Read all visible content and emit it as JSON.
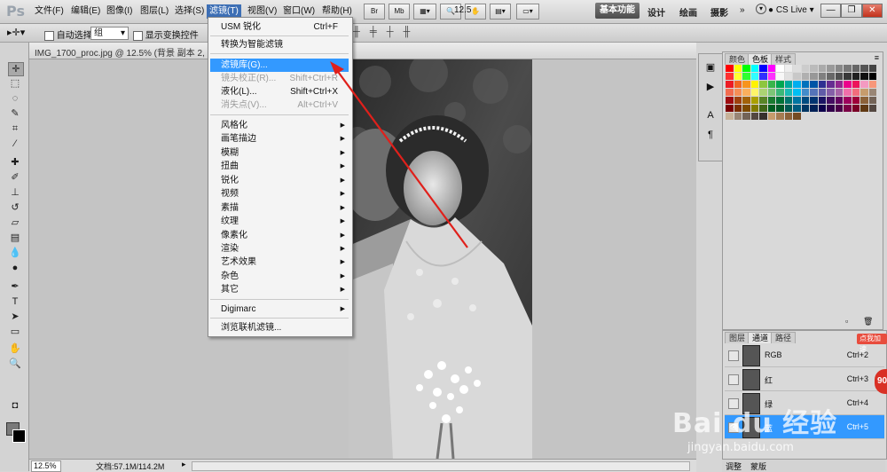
{
  "menubar": {
    "logo": "Ps",
    "items": [
      "文件(F)",
      "编辑(E)",
      "图像(I)",
      "图层(L)",
      "选择(S)",
      "滤镜(T)",
      "视图(V)",
      "窗口(W)",
      "帮助(H)"
    ],
    "zoom": "12.5",
    "workspace_active": "基本功能",
    "workspaces": [
      "设计",
      "绘画",
      "摄影"
    ],
    "cs_live": "CS Live",
    "bridge_btn": "Br",
    "mini_btn": "Mb"
  },
  "options": {
    "auto_select_label": "自动选择:",
    "group_value": "组",
    "transform_label": "显示变换控件"
  },
  "document": {
    "title": "IMG_1700_proc.jpg @ 12.5% (背景 副本 2, 蓝/8)",
    "status_zoom": "12.5%",
    "status_doc": "文档:57.1M/114.2M"
  },
  "filter_menu": {
    "items": [
      {
        "label": "USM 锐化",
        "shortcut": "Ctrl+F"
      },
      {
        "label": "转换为智能滤镜",
        "shortcut": ""
      },
      {
        "label": "滤镜库(G)...",
        "shortcut": ""
      },
      {
        "label": "镜头校正(R)...",
        "shortcut": "Shift+Ctrl+R"
      },
      {
        "label": "液化(L)...",
        "shortcut": "Shift+Ctrl+X"
      },
      {
        "label": "消失点(V)...",
        "shortcut": "Alt+Ctrl+V"
      },
      {
        "label": "风格化"
      },
      {
        "label": "画笔描边"
      },
      {
        "label": "模糊"
      },
      {
        "label": "扭曲"
      },
      {
        "label": "锐化"
      },
      {
        "label": "视频"
      },
      {
        "label": "素描"
      },
      {
        "label": "纹理"
      },
      {
        "label": "像素化"
      },
      {
        "label": "渲染"
      },
      {
        "label": "艺术效果"
      },
      {
        "label": "杂色"
      },
      {
        "label": "其它"
      },
      {
        "label": "Digimarc"
      },
      {
        "label": "浏览联机滤镜..."
      }
    ]
  },
  "swatch_panel": {
    "tabs": [
      "颜色",
      "色板",
      "样式"
    ],
    "colors": [
      "#ff0000",
      "#ffff00",
      "#00ff00",
      "#00ffff",
      "#0000ff",
      "#ff00ff",
      "#ffffff",
      "#eeeeee",
      "#dddddd",
      "#cccccc",
      "#bbbbbb",
      "#aaaaaa",
      "#999999",
      "#888888",
      "#777777",
      "#666666",
      "#555555",
      "#444444",
      "#ff3030",
      "#ffff30",
      "#30ff30",
      "#30ffff",
      "#3030ff",
      "#ff30ff",
      "#f7f7f7",
      "#e0e0e0",
      "#c8c8c8",
      "#b0b0b0",
      "#989898",
      "#808080",
      "#686868",
      "#505050",
      "#383838",
      "#202020",
      "#101010",
      "#000000",
      "#ed1c24",
      "#f26522",
      "#f7941d",
      "#fff200",
      "#8dc63f",
      "#39b54a",
      "#00a651",
      "#00a99d",
      "#00aeef",
      "#0072bc",
      "#0054a6",
      "#2e3192",
      "#662d91",
      "#92278f",
      "#ec008c",
      "#ed145b",
      "#f49ac1",
      "#f7977a",
      "#f26c4f",
      "#f68e56",
      "#fbaf5d",
      "#fff568",
      "#acd373",
      "#7cc576",
      "#3bb878",
      "#1abbb4",
      "#00bff3",
      "#438ccb",
      "#5574b9",
      "#605ca8",
      "#855fa8",
      "#a763a8",
      "#f06eaa",
      "#f26d7d",
      "#c69c6d",
      "#998675",
      "#9e0b0f",
      "#a0410d",
      "#a36209",
      "#aba000",
      "#598527",
      "#1a7b30",
      "#007236",
      "#00746b",
      "#0076a3",
      "#004b80",
      "#003471",
      "#1b1464",
      "#440e62",
      "#630460",
      "#9e005d",
      "#9e0039",
      "#8c6239",
      "#736357",
      "#790000",
      "#7b2e00",
      "#7d4900",
      "#827b00",
      "#406618",
      "#005e20",
      "#005826",
      "#005952",
      "#005b7f",
      "#003663",
      "#002157",
      "#0d004c",
      "#32004b",
      "#4b0049",
      "#7b0046",
      "#7a0026",
      "#603913",
      "#534741",
      "#c7b299",
      "#998675",
      "#736357",
      "#534741",
      "#37302d",
      "#c69c6d",
      "#a67c52",
      "#8c6239",
      "#754c24"
    ]
  },
  "channels_panel": {
    "tabs": [
      "图层",
      "通道",
      "路径"
    ],
    "rows": [
      {
        "name": "RGB",
        "shortcut": "Ctrl+2"
      },
      {
        "name": "红",
        "shortcut": "Ctrl+3"
      },
      {
        "name": "绿",
        "shortcut": "Ctrl+4"
      },
      {
        "name": "蓝",
        "shortcut": "Ctrl+5"
      }
    ]
  },
  "bottom_tabs": [
    "调整",
    "蒙版"
  ],
  "overlay": {
    "watermark": "Bai du 经验",
    "watermark_url": "jingyan.baidu.com",
    "badge_number": "90",
    "badge_text": "点我加速"
  }
}
